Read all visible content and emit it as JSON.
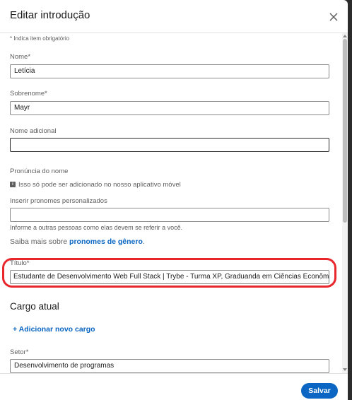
{
  "dialog": {
    "title": "Editar introdução",
    "required_note": "* Indica item obrigatório",
    "save_label": "Salvar"
  },
  "fields": {
    "nome": {
      "label": "Nome*",
      "value": "Letícia"
    },
    "sobrenome": {
      "label": "Sobrenome*",
      "value": "Mayr"
    },
    "nome_adicional": {
      "label": "Nome adicional",
      "value": ""
    },
    "pronuncia": {
      "label": "Pronúncia do nome",
      "info": "Isso só pode ser adicionado no nosso aplicativo móvel"
    },
    "pronomes": {
      "label": "Inserir pronomes personalizados",
      "value": "",
      "helper": "Informe a outras pessoas como elas devem se referir a você.",
      "saiba_prefix": "Saiba mais sobre ",
      "saiba_link": "pronomes de gênero",
      "saiba_suffix": "."
    },
    "titulo": {
      "label": "Título*",
      "value": "Estudante de Desenvolvimento Web Full Stack | Trybe - Turma XP, Graduanda em Ciências Econômicas | UI"
    },
    "setor": {
      "label": "Setor*",
      "value": "Desenvolvimento de programas"
    }
  },
  "cargo": {
    "section_title": "Cargo atual",
    "add_label": "+ Adicionar novo cargo"
  },
  "colors": {
    "accent": "#0a66c2",
    "highlight": "#e8262c"
  }
}
